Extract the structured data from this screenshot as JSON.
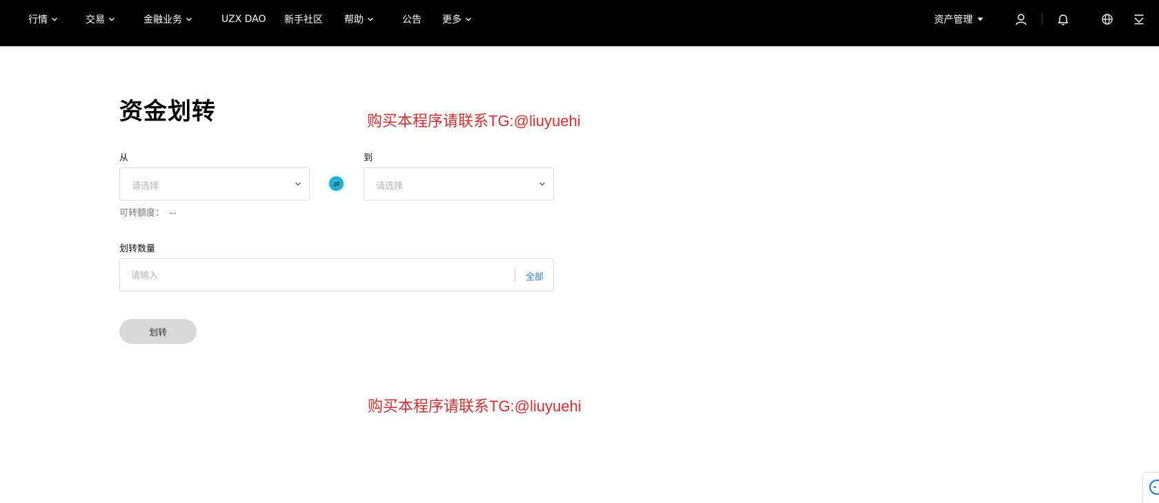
{
  "nav": {
    "items": [
      {
        "label": "行情",
        "dropdown": true
      },
      {
        "label": "交易",
        "dropdown": true
      },
      {
        "label": "金融业务",
        "dropdown": true
      },
      {
        "label": "UZX DAO",
        "dropdown": false
      },
      {
        "label": "新手社区",
        "dropdown": false
      },
      {
        "label": "帮助",
        "dropdown": true
      },
      {
        "label": "公告",
        "dropdown": false
      },
      {
        "label": "更多",
        "dropdown": true
      }
    ],
    "asset_management": "资产管理",
    "icons": [
      "user-icon",
      "bell-icon",
      "globe-icon",
      "download-icon"
    ]
  },
  "page": {
    "title": "资金划转",
    "watermark": "购买本程序请联系TG:@liuyuehi"
  },
  "form": {
    "from_label": "从",
    "to_label": "到",
    "from_placeholder": "请选择",
    "to_placeholder": "请选择",
    "available_label": "可转额度：",
    "available_value": "--",
    "amount_label": "划转数量",
    "amount_placeholder": "请输入",
    "all_label": "全部",
    "submit_label": "划转"
  },
  "colors": {
    "topbar": "#000000",
    "watermark": "#e02b2b",
    "link": "#2a7fd4",
    "swap_accent": "#18a9cc",
    "button_disabled": "#d9d9d9"
  }
}
